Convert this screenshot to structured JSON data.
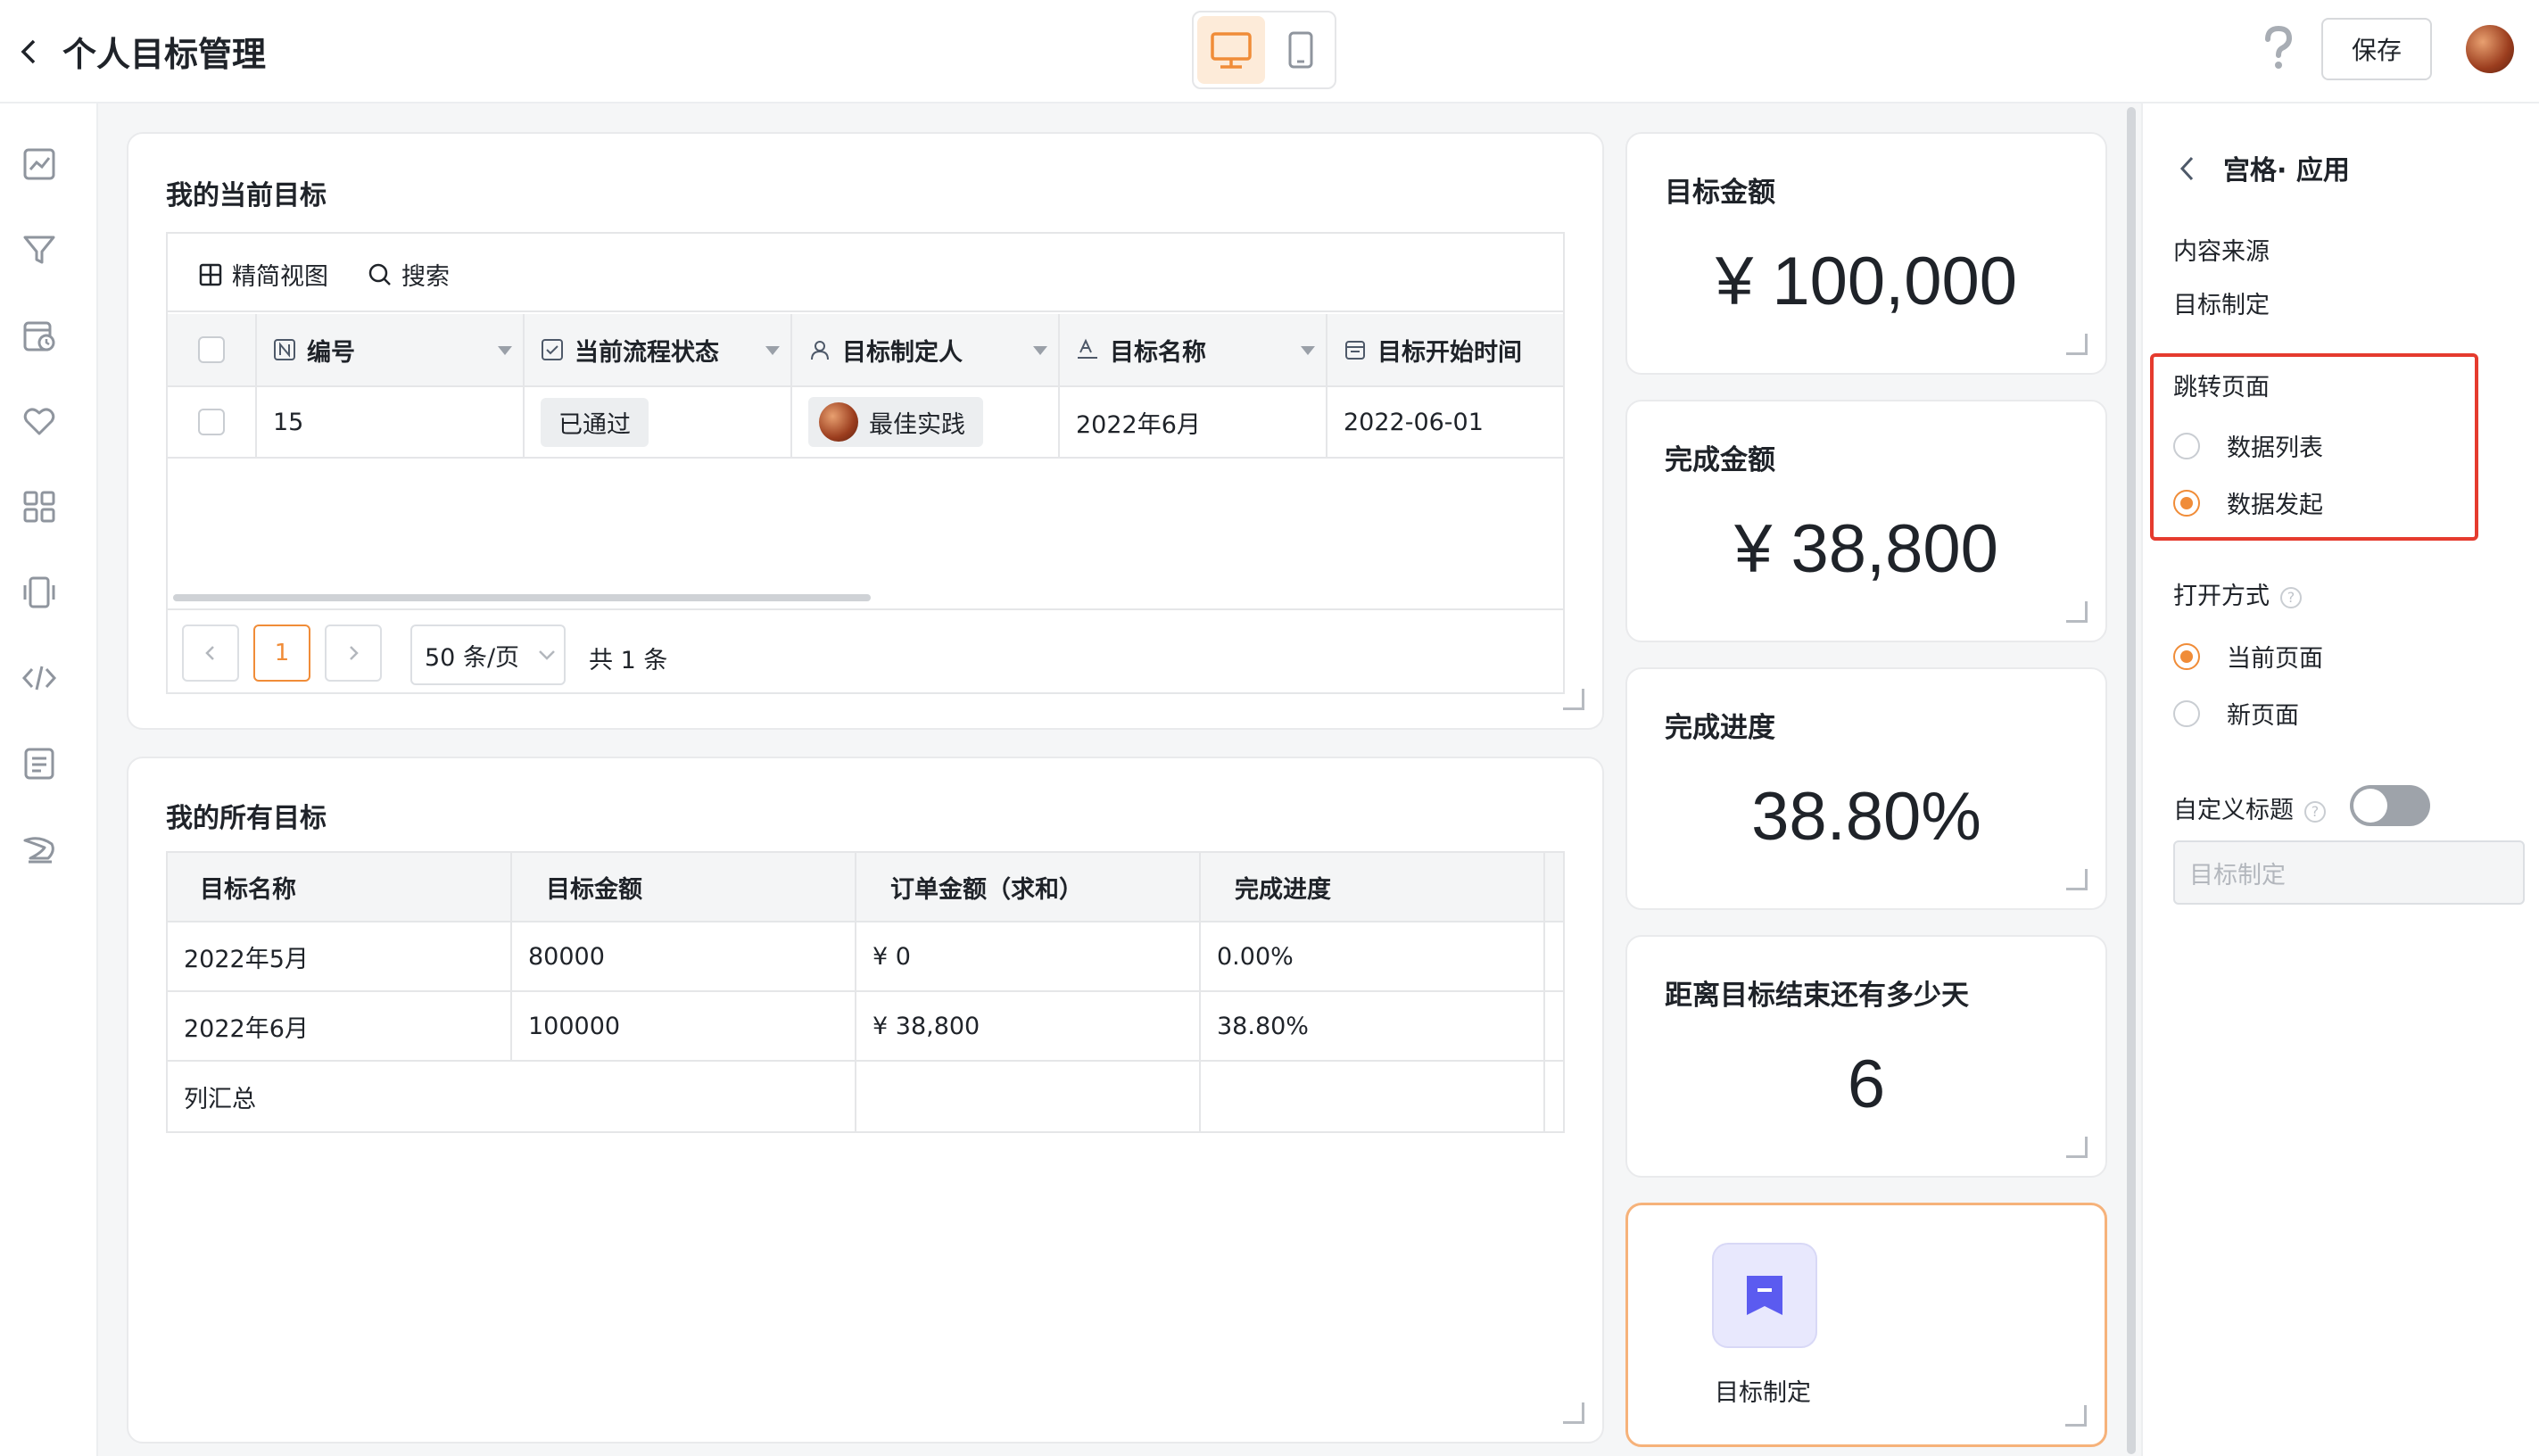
{
  "header": {
    "title": "个人目标管理",
    "save_label": "保存",
    "accent_color": "#f08c38"
  },
  "sidebar": {
    "icons": [
      "chart-icon",
      "filter-icon",
      "calendar-icon",
      "heart-icon",
      "grid-icon",
      "mobile-icon",
      "code-icon",
      "document-icon",
      "feather-icon"
    ]
  },
  "current_goals": {
    "title": "我的当前目标",
    "toolbar": {
      "view_label": "精简视图",
      "search_label": "搜索"
    },
    "columns": [
      "编号",
      "当前流程状态",
      "目标制定人",
      "目标名称",
      "目标开始时间"
    ],
    "rows": [
      {
        "id": "15",
        "status": "已通过",
        "owner": "最佳实践",
        "name": "2022年6月",
        "start": "2022-06-01"
      }
    ],
    "pagination": {
      "page": "1",
      "page_size": "50 条/页",
      "total": "共 1 条"
    }
  },
  "all_goals": {
    "title": "我的所有目标",
    "columns": [
      "目标名称",
      "目标金额",
      "订单金额（求和）",
      "完成进度"
    ],
    "rows": [
      [
        "2022年5月",
        "80000",
        "¥ 0",
        "0.00%"
      ],
      [
        "2022年6月",
        "100000",
        "¥ 38,800",
        "38.80%"
      ]
    ],
    "summary_label": "列汇总"
  },
  "metrics": {
    "target_amount": {
      "title": "目标金额",
      "value": "¥ 100,000"
    },
    "completed_amount": {
      "title": "完成金额",
      "value": "¥ 38,800"
    },
    "progress": {
      "title": "完成进度",
      "value": "38.80%",
      "fraction": 0.388
    },
    "days_left": {
      "title": "距离目标结束还有多少天",
      "value": "6"
    }
  },
  "action": {
    "label": "目标制定",
    "icon": "form-icon"
  },
  "panel": {
    "title": "宫格· 应用",
    "source_label": "内容来源",
    "source_value": "目标制定",
    "jump_label": "跳转页面",
    "jump_options": [
      "数据列表",
      "数据发起"
    ],
    "jump_selected": "数据发起",
    "open_label": "打开方式",
    "open_options": [
      "当前页面",
      "新页面"
    ],
    "open_selected": "当前页面",
    "custom_title_label": "自定义标题",
    "custom_title_enabled": false,
    "custom_title_placeholder": "目标制定",
    "highlight_color": "#e53b2e"
  }
}
